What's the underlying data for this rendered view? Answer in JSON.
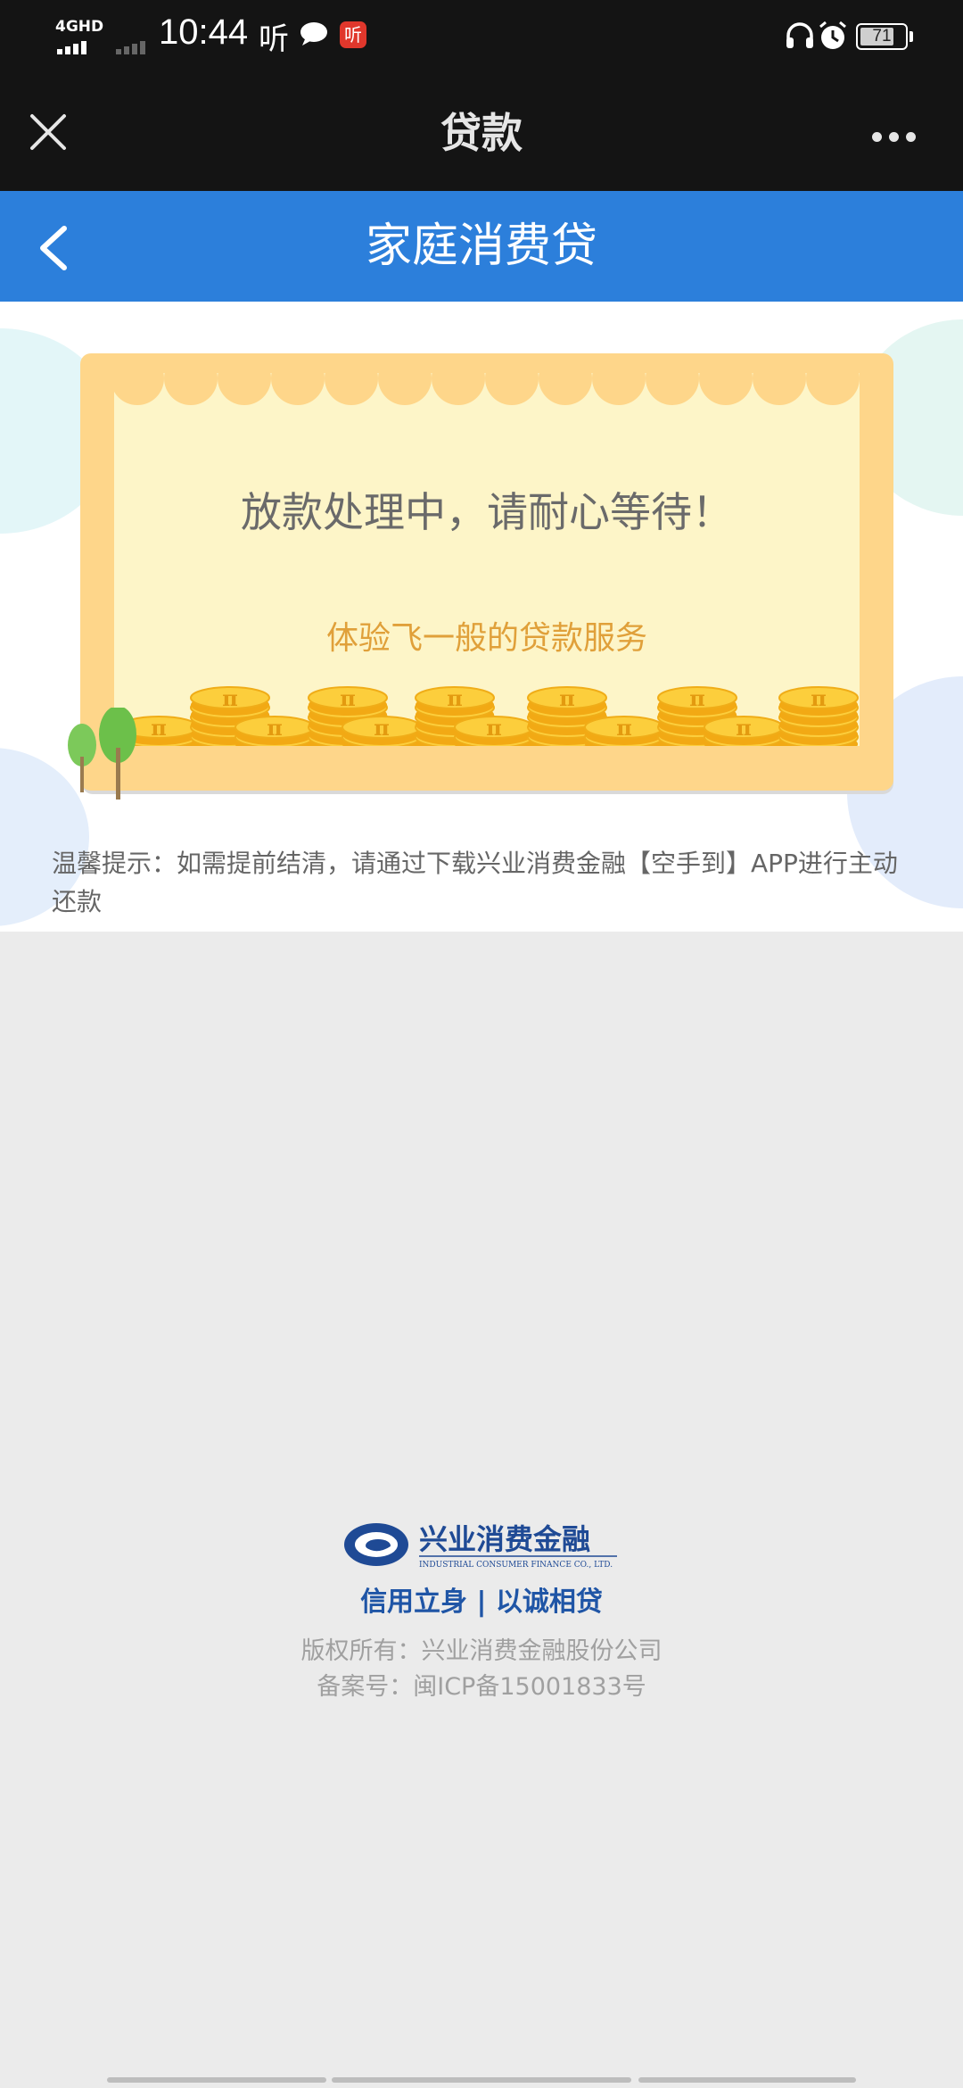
{
  "status_bar": {
    "network": "4GHD",
    "time": "10:44",
    "listen_glyph": "听",
    "app_badge": "听",
    "battery": "71",
    "icons": [
      "signal-icon",
      "chat-bubble-icon",
      "headphones-icon",
      "alarm-icon",
      "battery-icon"
    ]
  },
  "title_bar": {
    "title": "贷款",
    "close_icon": "close-icon",
    "more_icon": "more-dots-icon"
  },
  "header": {
    "title": "家庭消费贷",
    "back_icon": "chevron-left-icon",
    "color": "#2c7fdb"
  },
  "card": {
    "main_message": "放款处理中，请耐心等待！",
    "sub_message": "体验飞一般的贷款服务",
    "coin_symbol": "π"
  },
  "tip": "温馨提示：如需提前结清，请通过下载兴业消费金融【空手到】APP进行主动还款",
  "footer": {
    "logo_name": "兴业消费金融",
    "logo_english": "INDUSTRIAL CONSUMER FINANCE CO., LTD.",
    "slogan": "信用立身 | 以诚相贷",
    "copyright": "版权所有：兴业消费金融股份公司",
    "icp": "备案号：闽ICP备15001833号"
  }
}
